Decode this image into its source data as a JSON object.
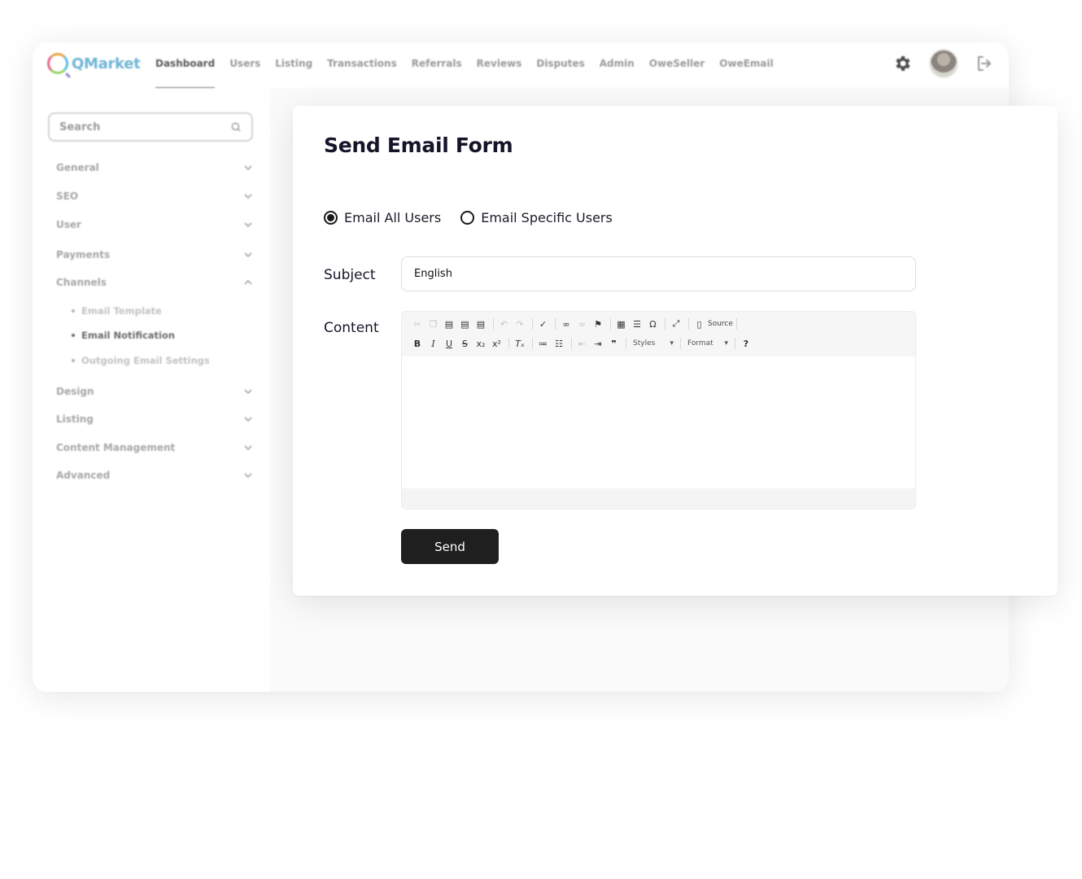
{
  "app": {
    "brand": "QMarket",
    "nav": [
      "Dashboard",
      "Users",
      "Listing",
      "Transactions",
      "Referrals",
      "Reviews",
      "Disputes",
      "Admin",
      "OweSeller",
      "OweEmail"
    ],
    "active_nav": "Dashboard"
  },
  "sidebar": {
    "search_placeholder": "Search",
    "items": [
      {
        "label": "General"
      },
      {
        "label": "SEO"
      },
      {
        "label": "User"
      },
      {
        "label": "Payments"
      },
      {
        "label": "Channels",
        "expanded": true
      },
      {
        "label": "Design"
      },
      {
        "label": "Listing"
      },
      {
        "label": "Content Management"
      },
      {
        "label": "Advanced"
      }
    ],
    "channels_sub": [
      {
        "label": "Email Template"
      },
      {
        "label": "Email Notification",
        "active": true
      },
      {
        "label": "Outgoing Email Settings"
      }
    ]
  },
  "form": {
    "title": "Send Email Form",
    "recipient_options": [
      {
        "label": "Email All Users",
        "selected": true
      },
      {
        "label": "Email Specific Users",
        "selected": false
      }
    ],
    "subject_label": "Subject",
    "subject_value": "English",
    "content_label": "Content",
    "toolbar": {
      "source_label": "Source",
      "styles_label": "Styles",
      "format_label": "Format",
      "help_label": "?"
    },
    "send_label": "Send"
  }
}
